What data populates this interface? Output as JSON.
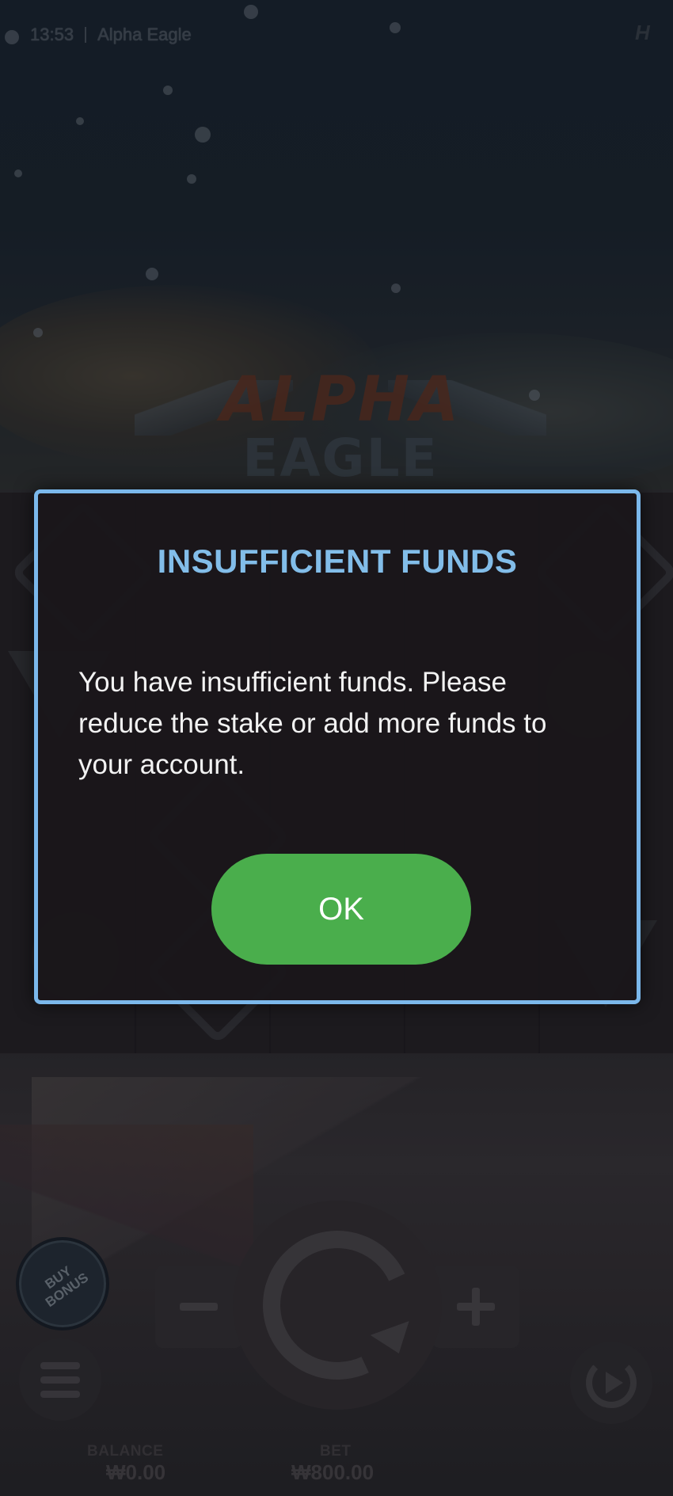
{
  "status_bar": {
    "time": "13:53",
    "app_title": "Alpha Eagle"
  },
  "game": {
    "logo_line1": "ALPHA",
    "logo_line2": "EAGLE",
    "buy_bonus_label": "BUY BONUS",
    "balance_label": "BALANCE",
    "balance_value": "₩0.00",
    "bet_label": "BET",
    "bet_value": "₩800.00"
  },
  "dialog": {
    "title": "INSUFFICIENT FUNDS",
    "message": "You have insufficient funds. Please reduce the stake or add more funds to your account.",
    "ok_label": "OK",
    "border_color": "#7bb8eb",
    "title_color": "#82bde9",
    "ok_color": "#4aae4c"
  }
}
